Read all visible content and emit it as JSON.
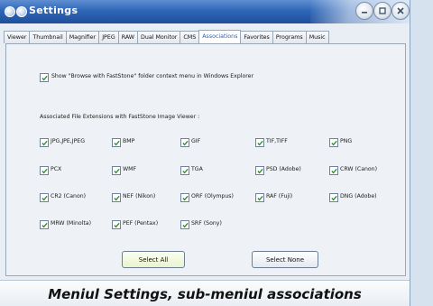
{
  "window": {
    "title": "Settings"
  },
  "tabs": [
    {
      "label": "Viewer",
      "active": false
    },
    {
      "label": "Thumbnail",
      "active": false
    },
    {
      "label": "Magnifier",
      "active": false
    },
    {
      "label": "JPEG",
      "active": false
    },
    {
      "label": "RAW",
      "active": false
    },
    {
      "label": "Dual Monitor",
      "active": false
    },
    {
      "label": "CMS",
      "active": false
    },
    {
      "label": "Associations",
      "active": true
    },
    {
      "label": "Favorites",
      "active": false
    },
    {
      "label": "Programs",
      "active": false
    },
    {
      "label": "Music",
      "active": false
    }
  ],
  "context_menu_option": {
    "label": "Show \"Browse with FastStone\" folder context menu in Windows Explorer",
    "checked": true
  },
  "associations": {
    "heading": "Associated File Extensions with FastStone Image Viewer :",
    "items": [
      {
        "label": "JPG,JPE,JPEG",
        "checked": true
      },
      {
        "label": "BMP",
        "checked": true
      },
      {
        "label": "GIF",
        "checked": true
      },
      {
        "label": "TIF,TIFF",
        "checked": true
      },
      {
        "label": "PNG",
        "checked": true
      },
      {
        "label": "PCX",
        "checked": true
      },
      {
        "label": "WMF",
        "checked": true
      },
      {
        "label": "TGA",
        "checked": true
      },
      {
        "label": "PSD (Adobe)",
        "checked": true
      },
      {
        "label": "CRW (Canon)",
        "checked": true
      },
      {
        "label": "CR2 (Canon)",
        "checked": true
      },
      {
        "label": "NEF (Nikon)",
        "checked": true
      },
      {
        "label": "ORF (Olympus)",
        "checked": true
      },
      {
        "label": "RAF (Fuji)",
        "checked": true
      },
      {
        "label": "DNG (Adobe)",
        "checked": true
      },
      {
        "label": "MRW (Minolta)",
        "checked": true
      },
      {
        "label": "PEF (Pentax)",
        "checked": true
      },
      {
        "label": "SRF (Sony)",
        "checked": true
      }
    ]
  },
  "buttons": {
    "select_all": "Select All",
    "select_none": "Select None"
  },
  "caption": "Meniul Settings, sub-meniul associations",
  "colors": {
    "titlebar": "#2f66b8",
    "active_tab_text": "#2a5fb0",
    "check": "#2b8a2b"
  }
}
